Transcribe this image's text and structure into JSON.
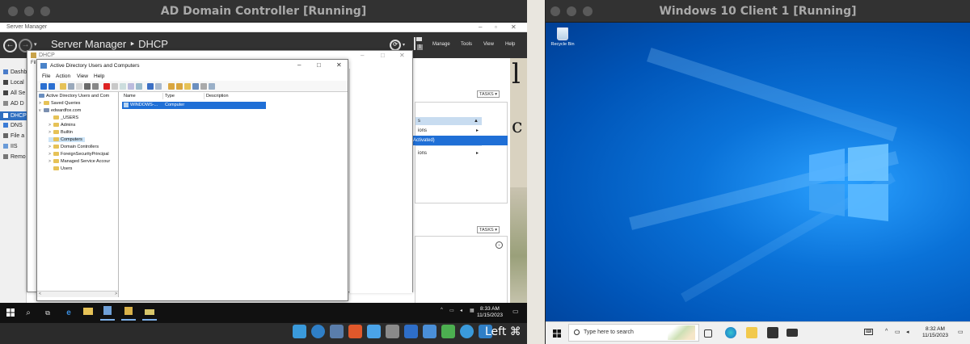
{
  "host": {
    "left_vm_title": "AD Domain Controller [Running]",
    "right_vm_title": "Windows 10 Client 1 [Running]",
    "dock_text": "Left ⌘"
  },
  "server_manager": {
    "caption": "Server Manager",
    "breadcrumb": "Server Manager ‣ DHCP",
    "menu": [
      "Manage",
      "Tools",
      "View",
      "Help"
    ],
    "sidebar": [
      "Dashb",
      "Local",
      "All Se",
      "AD D",
      "DHCP",
      "DNS",
      "File a",
      "IIS",
      "Remo"
    ],
    "tasks_label": "TASKS",
    "rows": [
      "ions",
      "ions"
    ],
    "row_labels_top": "s",
    "activated_text": "Activated)"
  },
  "dhcp_window": {
    "title": "DHCP",
    "menu_hint": "Fil"
  },
  "aduc": {
    "title": "Active Directory Users and Computers",
    "menu": [
      "File",
      "Action",
      "View",
      "Help"
    ],
    "tree": [
      {
        "label": "Active Directory Users and Com",
        "level": 0,
        "exp": ""
      },
      {
        "label": "Saved Queries",
        "level": 1,
        "exp": ">"
      },
      {
        "label": "edwardfox.com",
        "level": 1,
        "exp": "v"
      },
      {
        "label": "_USERS",
        "level": 2,
        "exp": ""
      },
      {
        "label": "Admins",
        "level": 2,
        "exp": ">"
      },
      {
        "label": "Builtin",
        "level": 2,
        "exp": ">"
      },
      {
        "label": "Computers",
        "level": 2,
        "exp": ""
      },
      {
        "label": "Domain Controllers",
        "level": 2,
        "exp": ">"
      },
      {
        "label": "ForeignSecurityPrincipal",
        "level": 2,
        "exp": ">"
      },
      {
        "label": "Managed Service Accour",
        "level": 2,
        "exp": ">"
      },
      {
        "label": "Users",
        "level": 2,
        "exp": ""
      }
    ],
    "columns": [
      "Name",
      "Type",
      "Description"
    ],
    "rows": [
      {
        "name": "WINDOWS-...",
        "type": "Computer",
        "description": ""
      }
    ]
  },
  "left_taskbar": {
    "time": "8:33 AM",
    "date": "11/15/2023"
  },
  "win10": {
    "recycle_bin": "Recycle Bin",
    "search_placeholder": "Type here to search",
    "time": "8:32 AM",
    "date": "11/15/2023"
  },
  "colors": {
    "accent_blue": "#1f6fd6",
    "sm_header": "#323232",
    "desktop_blue": "#0078d7"
  }
}
